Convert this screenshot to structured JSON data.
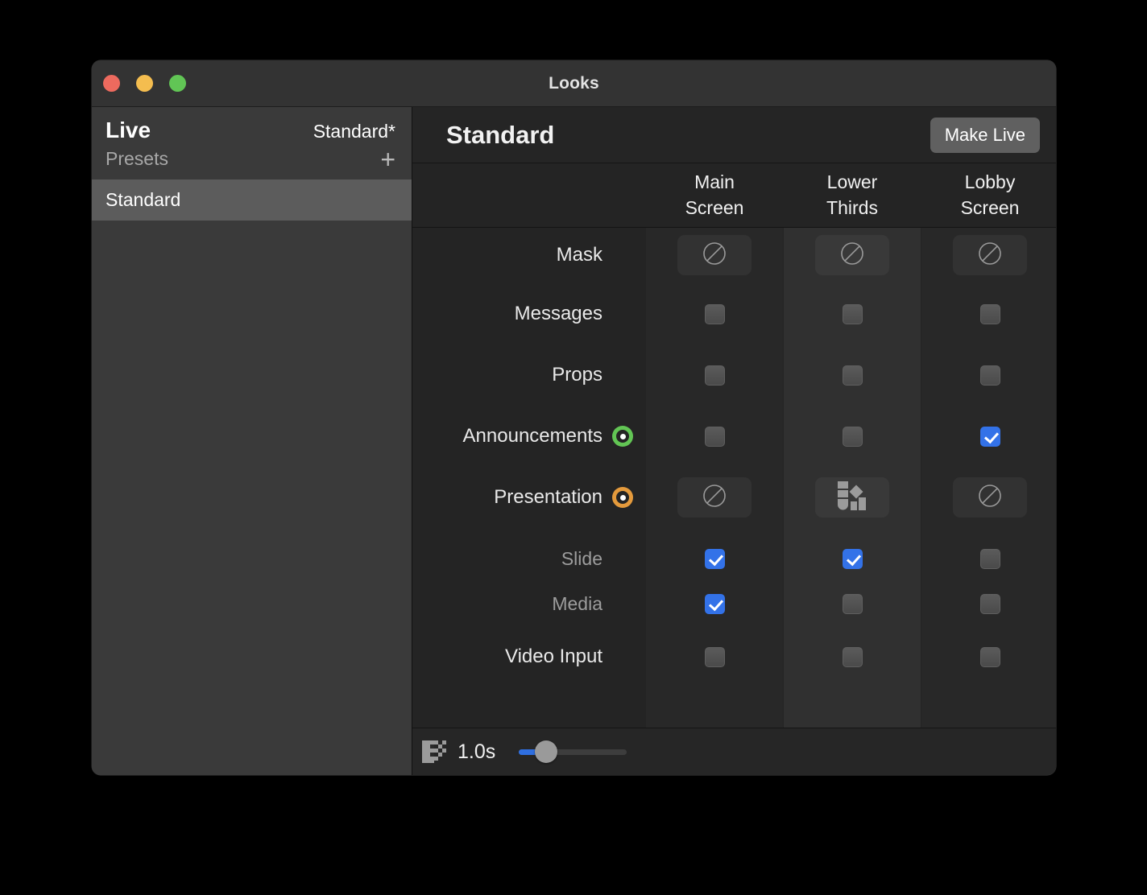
{
  "window": {
    "title": "Looks",
    "traffic_lights": [
      "close-red",
      "minimize-yellow",
      "zoom-green"
    ]
  },
  "sidebar": {
    "live_label": "Live",
    "live_value": "Standard*",
    "presets_label": "Presets",
    "add_icon": "+",
    "presets": [
      {
        "label": "Standard",
        "selected": true
      }
    ]
  },
  "detail": {
    "title": "Standard",
    "make_live_label": "Make Live",
    "columns": [
      {
        "line1": "Main",
        "line2": "Screen"
      },
      {
        "line1": "Lower",
        "line2": "Thirds"
      },
      {
        "line1": "Lobby",
        "line2": "Screen"
      }
    ],
    "rows": [
      {
        "label": "Mask",
        "kind": "iconbtn",
        "dim": false,
        "badge": null,
        "cells": [
          "none-icon",
          "none-icon",
          "none-icon"
        ]
      },
      {
        "label": "Messages",
        "kind": "checkbox",
        "dim": false,
        "badge": null,
        "cells": [
          false,
          false,
          false
        ]
      },
      {
        "label": "Props",
        "kind": "checkbox",
        "dim": false,
        "badge": null,
        "cells": [
          false,
          false,
          false
        ]
      },
      {
        "label": "Announcements",
        "kind": "checkbox",
        "dim": false,
        "badge": "green",
        "cells": [
          false,
          false,
          true
        ]
      },
      {
        "label": "Presentation",
        "kind": "iconbtn",
        "dim": false,
        "badge": "orange",
        "cells": [
          "none-icon",
          "shapes-icon",
          "none-icon"
        ]
      },
      {
        "label": "Slide",
        "kind": "checkbox",
        "dim": true,
        "badge": null,
        "cells": [
          true,
          true,
          false
        ]
      },
      {
        "label": "Media",
        "kind": "checkbox",
        "dim": true,
        "badge": null,
        "cells": [
          true,
          false,
          false
        ]
      },
      {
        "label": "Video Input",
        "kind": "checkbox",
        "dim": false,
        "badge": null,
        "cells": [
          false,
          false,
          false
        ]
      }
    ]
  },
  "toolbar": {
    "transition_icon": "dissolve-icon",
    "duration_label": "1.0s",
    "slider_value": 0.22
  },
  "colors": {
    "accent_blue": "#3372e8",
    "badge_green": "#62c554",
    "badge_orange": "#e49a3c",
    "window_bg": "#232323",
    "sidebar_bg": "#3a3a3a"
  }
}
